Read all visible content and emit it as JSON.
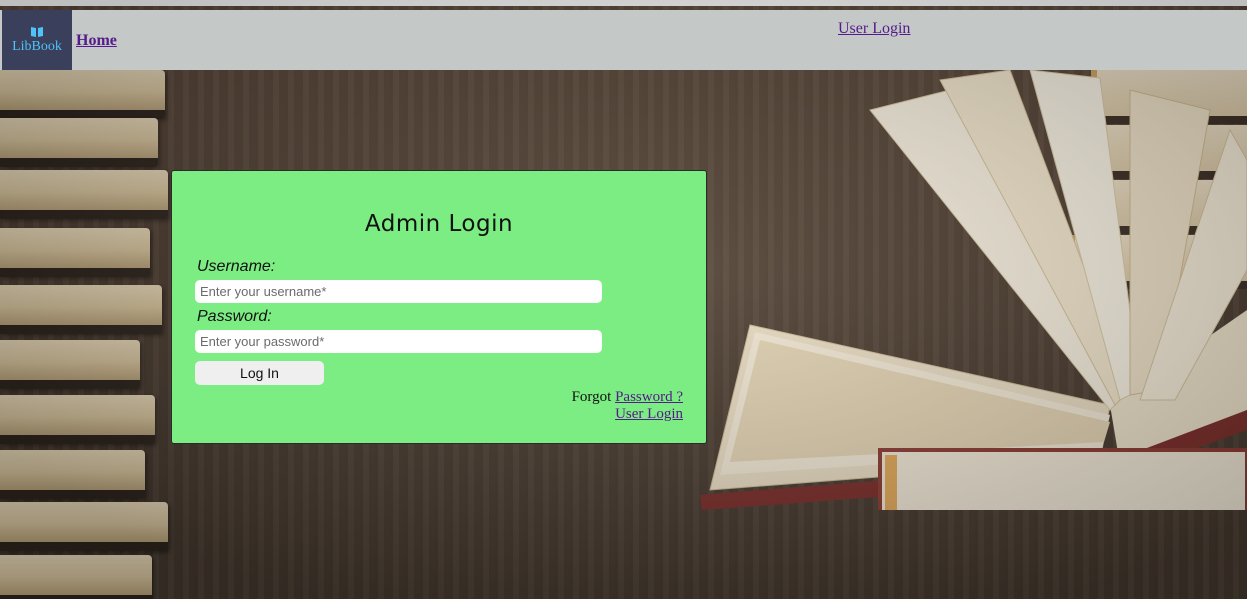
{
  "brand": {
    "logo_text": "LibBook",
    "logo_icon": "book-icon"
  },
  "nav": {
    "home_label": "Home",
    "user_login_label": "User Login"
  },
  "login": {
    "title": "Admin Login",
    "username_label": "Username:",
    "username_placeholder": "Enter your username*",
    "password_label": "Password:",
    "password_placeholder": "Enter your password*",
    "submit_label": "Log In",
    "forgot_prefix": "Forgot",
    "forgot_link": "Password ?",
    "user_login_link": "User Login"
  },
  "colors": {
    "navbar": "#c4c9c7",
    "card": "#7bed82",
    "link": "#551a8b",
    "logo_bg": "#3a3f5c",
    "logo_text": "#4fc3f7"
  }
}
